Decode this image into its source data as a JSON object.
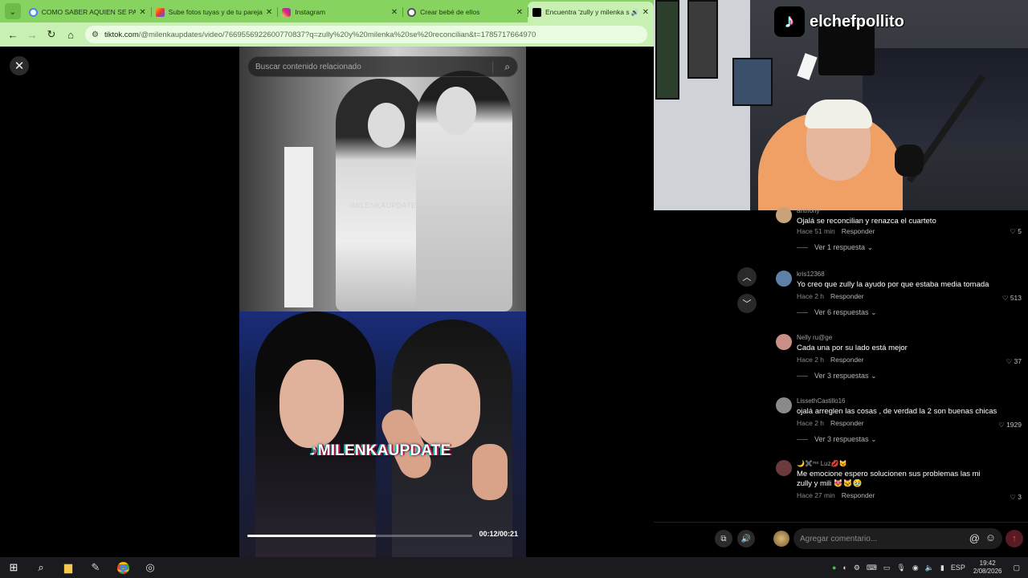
{
  "browser": {
    "tabs": [
      {
        "title": "COMO SABER AQUIEN SE PAREC",
        "favicon": "google-icon",
        "color": "#ffffff",
        "active": false
      },
      {
        "title": "Sube fotos tuyas y de tu pareja",
        "favicon": "gallery-icon",
        "color": "#f5b400",
        "active": false
      },
      {
        "title": "Instagram",
        "favicon": "instagram-icon",
        "color": "#d62976",
        "active": false
      },
      {
        "title": "Crear bebé de ellos",
        "favicon": "chatgpt-icon",
        "color": "#ffffff",
        "active": false
      },
      {
        "title": "Encuentra 'zully y milenka s",
        "favicon": "tiktok-icon",
        "color": "#000000",
        "active": true
      }
    ],
    "url_domain": "tiktok.com",
    "url_path": "/@milenkaupdates/video/7669556922600770837?q=zully%20y%20milenka%20se%20reconcilian&t=1785717664970"
  },
  "video": {
    "search_placeholder": "Buscar contenido relacionado",
    "watermark_top": "♪MILENKAUPDATE",
    "watermark_bottom": "♪MILENKAUPDATE",
    "progress": 0.57,
    "time": "00:12/00:21"
  },
  "stream": {
    "handle": "elchefpollito"
  },
  "comments": [
    {
      "user": "anthony",
      "text": "Ojalá se reconcilian y renazca el cuarteto",
      "time": "Hace 51 min",
      "reply": "Responder",
      "likes": "5",
      "replies": "Ver 1 respuesta",
      "avatar_color": "#c9a27a"
    },
    {
      "user": "kris12368",
      "text": "Yo creo que zully la ayudo por que estaba media tomada",
      "time": "Hace 2 h",
      "reply": "Responder",
      "likes": "513",
      "replies": "Ver 6 respuestas",
      "avatar_color": "#5e7fa8"
    },
    {
      "user": "Nelly ru@ge",
      "text": "Cada una por su lado está mejor",
      "time": "Hace 2 h",
      "reply": "Responder",
      "likes": "37",
      "replies": "Ver 3 respuestas",
      "avatar_color": "#c98f86"
    },
    {
      "user": "LissethCastillo16",
      "text": "ojalá arreglen las cosas , de verdad la 2 son buenas chicas",
      "time": "Hace 2 h",
      "reply": "Responder",
      "likes": "1929",
      "replies": "Ver 3 respuestas",
      "avatar_color": "#8a8a8a"
    },
    {
      "user": "🌙✖️ᵐᵉ Luz💋😼",
      "text": "Me emocione espero solucionen sus problemas las mi zully y mili 😻🐱🥹",
      "time": "Hace 27 min",
      "reply": "Responder",
      "likes": "3",
      "replies": "",
      "avatar_color": "#6b3b3b"
    }
  ],
  "composer": {
    "placeholder": "Agregar comentario..."
  },
  "taskbar": {
    "lang": "ESP",
    "time": "19:42",
    "date": "2/08/2026"
  }
}
